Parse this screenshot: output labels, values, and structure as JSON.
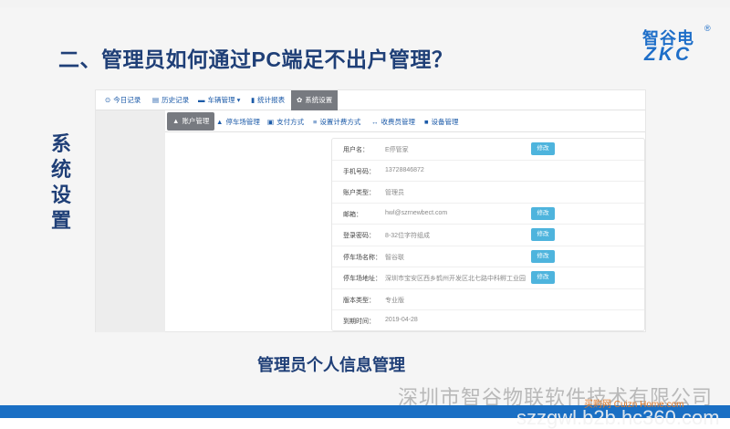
{
  "slide": {
    "title": "二、管理员如何通过PC端足不出户管理？",
    "side_label": "系统设置",
    "caption": "管理员个人信息管理"
  },
  "logo": {
    "text_cn": "智谷电",
    "reg_mark": "®",
    "text_en": "ZKC"
  },
  "topnav": [
    {
      "icon": "clock-icon",
      "glyph": "⊙",
      "label": "今日记录"
    },
    {
      "icon": "document-icon",
      "glyph": "▤",
      "label": "历史记录"
    },
    {
      "icon": "car-icon",
      "glyph": "▬",
      "label": "车辆管理 ▾"
    },
    {
      "icon": "bar-chart-icon",
      "glyph": "▮",
      "label": "统计报表"
    },
    {
      "icon": "gear-icon",
      "glyph": "✿",
      "label": "系统设置"
    }
  ],
  "subnav": [
    {
      "icon": "user-icon",
      "glyph": "▲",
      "label": "账户管理"
    },
    {
      "icon": "parking-icon",
      "glyph": "▲",
      "label": "停车场管理"
    },
    {
      "icon": "payment-icon",
      "glyph": "▣",
      "label": "支付方式"
    },
    {
      "icon": "list-icon",
      "glyph": "≡",
      "label": "设置计费方式"
    },
    {
      "icon": "link-icon",
      "glyph": "↔",
      "label": "收费员管理"
    },
    {
      "icon": "camera-icon",
      "glyph": "■",
      "label": "设备管理"
    }
  ],
  "account": {
    "rows": [
      {
        "label": "用户名：",
        "value": "E停管家",
        "button": "修改"
      },
      {
        "label": "手机号码：",
        "value": "13728846872",
        "button": ""
      },
      {
        "label": "账户类型：",
        "value": "管理员",
        "button": ""
      },
      {
        "label": "邮箱：",
        "value": "hwl@szrnewbect.com",
        "button": "修改"
      },
      {
        "label": "登录密码：",
        "value": "8-32位字符组成",
        "button": "修改"
      },
      {
        "label": "停车场名称：",
        "value": "智谷联",
        "button": "修改"
      },
      {
        "label": "停车场地址：",
        "value": "深圳市宝安区西乡鹤州开发区北七路中科孵工业园",
        "button": "修改"
      },
      {
        "label": "版本类型：",
        "value": "专业版",
        "button": ""
      },
      {
        "label": "到期时间：",
        "value": "2019-04-28",
        "button": ""
      }
    ]
  },
  "watermarks": {
    "company": "深圳市智谷物联软件技术有限公司",
    "url": "szzgwl.b2b.hc360.com",
    "site": "买购网 Cuizn Home.com"
  },
  "colors": {
    "title_blue": "#1f3f77",
    "brand_blue": "#1e6ec8",
    "active_tab": "#777a80",
    "button": "#4eb4dd"
  }
}
